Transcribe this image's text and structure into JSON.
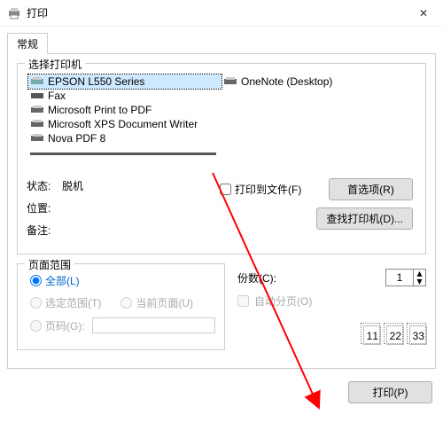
{
  "window": {
    "title": "打印",
    "close": "✕"
  },
  "tabs": {
    "general": "常规"
  },
  "printerGroup": {
    "legend": "选择打印机",
    "items": [
      "EPSON L550 Series",
      "OneNote (Desktop)",
      "Fax",
      "Microsoft Print to PDF",
      "Microsoft XPS Document Writer",
      "Nova PDF 8"
    ]
  },
  "status": {
    "state_lbl": "状态:",
    "state_val": "脱机",
    "loc_lbl": "位置:",
    "loc_val": "",
    "note_lbl": "备注:",
    "note_val": "",
    "toFile": "打印到文件(F)",
    "pref": "首选项(R)",
    "find": "查找打印机(D)..."
  },
  "range": {
    "legend": "页面范围",
    "all": "全部(L)",
    "sel": "选定范围(T)",
    "cur": "当前页面(U)",
    "pages": "页码(G):"
  },
  "copies": {
    "copies_lbl": "份数(C):",
    "count": "1",
    "collate": "自动分页(O)",
    "p1": "1",
    "p2": "2",
    "p3": "3"
  },
  "footer": {
    "print": "打印(P)"
  }
}
